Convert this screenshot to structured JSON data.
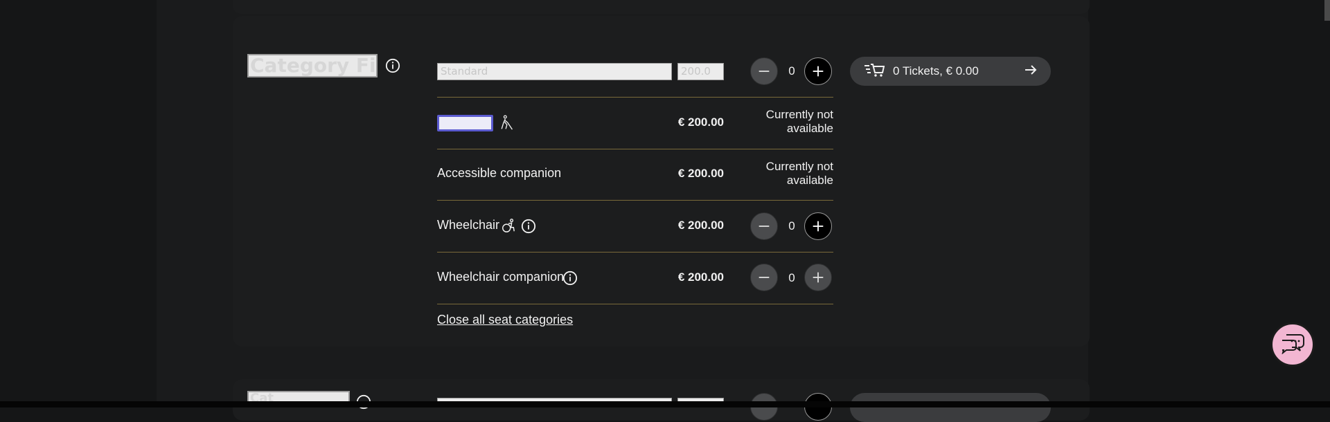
{
  "category": {
    "title": "Category First",
    "standard_placeholder": "Standard",
    "standard_price_placeholder": "200.0"
  },
  "rows": [
    {
      "label": "",
      "price": "€ 200.00",
      "status": "Currently not available",
      "icon": "blind-person-icon"
    },
    {
      "label": "Accessible companion",
      "price": "€ 200.00",
      "status": "Currently not available"
    },
    {
      "label": "Wheelchair",
      "price": "€ 200.00",
      "qty": "0",
      "icon": "wheelchair-icon"
    },
    {
      "label": "Wheelchair companion",
      "price": "€ 200.00",
      "qty": "0"
    }
  ],
  "standard": {
    "qty": "0"
  },
  "cart": {
    "label": "0 Tickets, € 0.00"
  },
  "close_link": "Close all seat categories",
  "next_category": {
    "title": "Cat"
  },
  "colors": {
    "accent_chat": "#f2b6d2",
    "divider": "#7a6a3a",
    "background": "#151617"
  }
}
